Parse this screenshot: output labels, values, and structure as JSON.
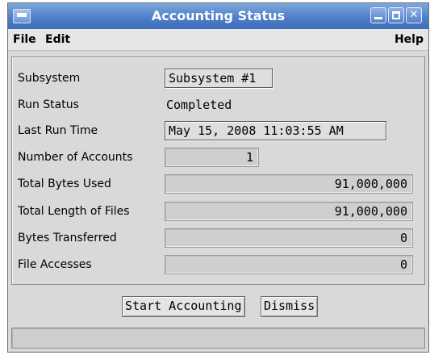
{
  "window": {
    "title": "Accounting Status"
  },
  "menu": {
    "file": "File",
    "edit": "Edit",
    "help": "Help"
  },
  "fields": {
    "subsystem": {
      "label": "Subsystem",
      "value": "Subsystem #1"
    },
    "run_status": {
      "label": "Run Status",
      "value": "Completed"
    },
    "last_run_time": {
      "label": "Last Run Time",
      "value": "May 15, 2008 11:03:55 AM"
    },
    "number_of_accounts": {
      "label": "Number of Accounts",
      "value": "1"
    },
    "total_bytes_used": {
      "label": "Total Bytes Used",
      "value": "91,000,000"
    },
    "total_length_of_files": {
      "label": "Total Length of Files",
      "value": "91,000,000"
    },
    "bytes_transferred": {
      "label": "Bytes Transferred",
      "value": "0"
    },
    "file_accesses": {
      "label": "File Accesses",
      "value": "0"
    }
  },
  "buttons": {
    "start_accounting": "Start Accounting",
    "dismiss": "Dismiss"
  },
  "status_text": "",
  "colors": {
    "titlebar": "#4f7fc9",
    "window_bg": "#d9d9d9"
  }
}
